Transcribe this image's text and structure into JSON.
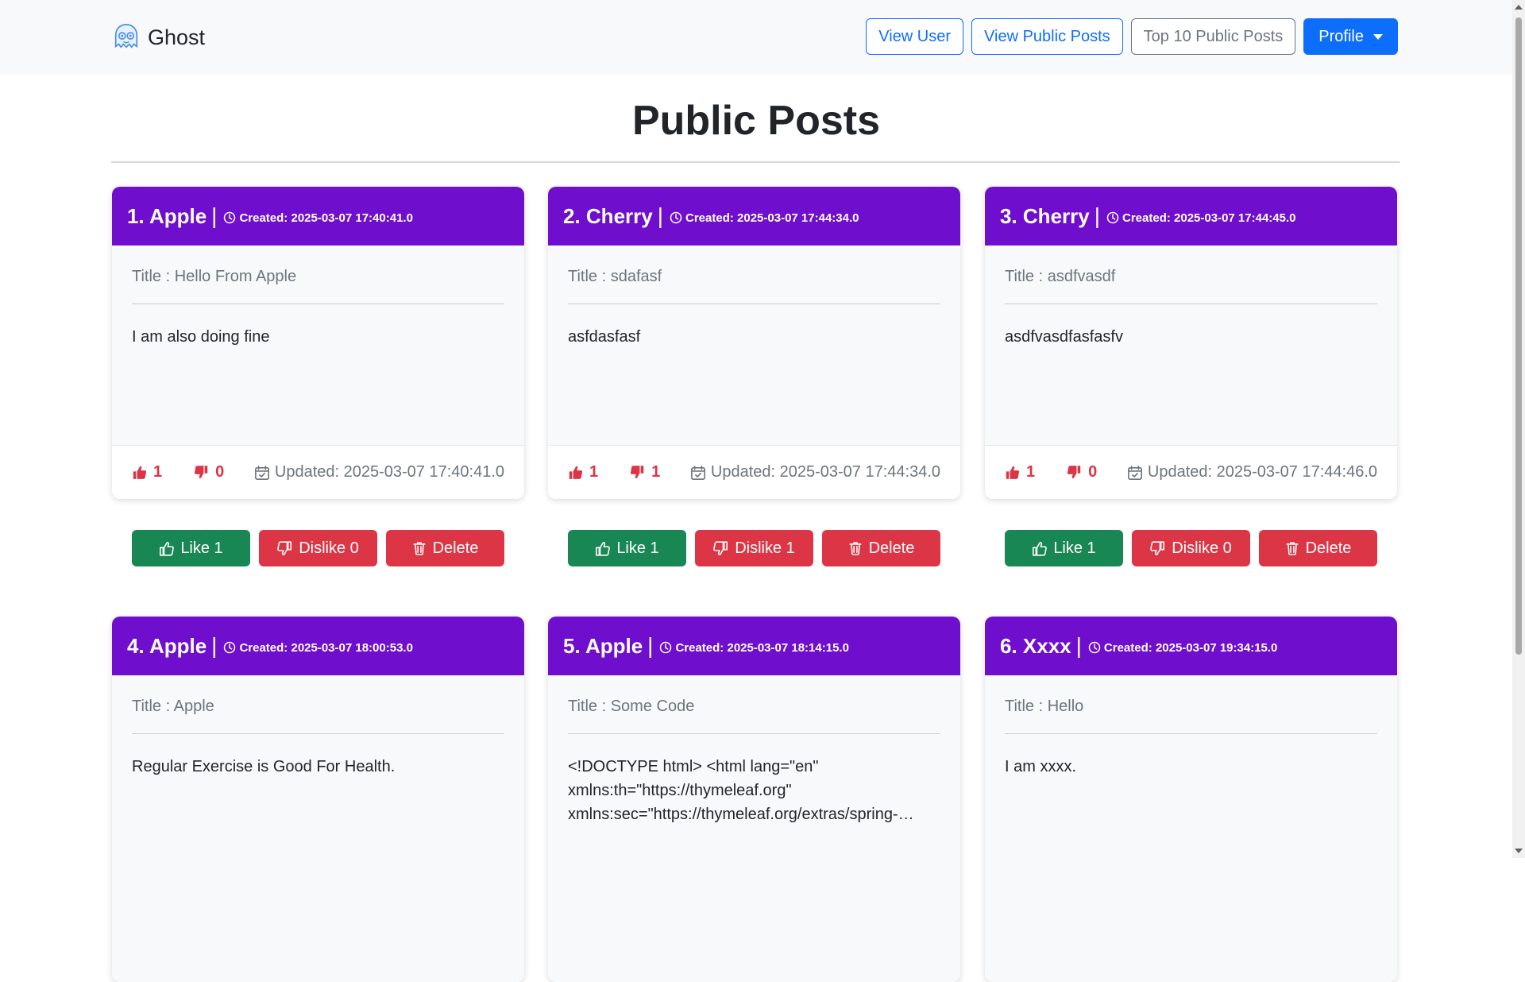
{
  "brand": {
    "name": "Ghost"
  },
  "nav": {
    "view_user": "View User",
    "view_public_posts": "View Public Posts",
    "top10": "Top 10 Public Posts",
    "profile": "Profile"
  },
  "page": {
    "title": "Public Posts"
  },
  "colors": {
    "header_purple": "#6f0fcd",
    "like_green": "#198754",
    "danger_red": "#dc3545",
    "primary_blue": "#0d6efd"
  },
  "posts": [
    {
      "name": "1. Apple",
      "separator": "|",
      "created": "Created: 2025-03-07 17:40:41.0",
      "title": "Title : Hello From Apple",
      "content": "I am also doing fine",
      "likes": "1",
      "dislikes": "0",
      "updated": "Updated: 2025-03-07 17:40:41.0",
      "like_btn": "Like 1",
      "dislike_btn": "Dislike 0",
      "delete_btn": "Delete"
    },
    {
      "name": "2. Cherry",
      "separator": "|",
      "created": "Created: 2025-03-07 17:44:34.0",
      "title": "Title : sdafasf",
      "content": "asfdasfasf",
      "likes": "1",
      "dislikes": "1",
      "updated": "Updated: 2025-03-07 17:44:34.0",
      "like_btn": "Like 1",
      "dislike_btn": "Dislike 1",
      "delete_btn": "Delete"
    },
    {
      "name": "3. Cherry",
      "separator": "|",
      "created": "Created: 2025-03-07 17:44:45.0",
      "title": "Title : asdfvasdf",
      "content": "asdfvasdfasfasfv",
      "likes": "1",
      "dislikes": "0",
      "updated": "Updated: 2025-03-07 17:44:46.0",
      "like_btn": "Like 1",
      "dislike_btn": "Dislike 0",
      "delete_btn": "Delete"
    },
    {
      "name": "4. Apple",
      "separator": "|",
      "created": "Created: 2025-03-07 18:00:53.0",
      "title": "Title : Apple",
      "content": "Regular Exercise is Good For Health."
    },
    {
      "name": "5. Apple",
      "separator": "|",
      "created": "Created: 2025-03-07 18:14:15.0",
      "title": "Title : Some Code",
      "content": "<!DOCTYPE html> <html lang=\"en\" xmlns:th=\"https://thymeleaf.org\" xmlns:sec=\"https://thymeleaf.org/extras/spring-…"
    },
    {
      "name": "6. Xxxx",
      "separator": "|",
      "created": "Created: 2025-03-07 19:34:15.0",
      "title": "Title : Hello",
      "content": "I am xxxx."
    }
  ]
}
